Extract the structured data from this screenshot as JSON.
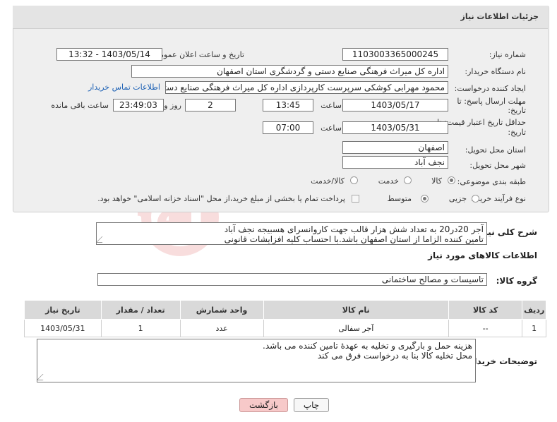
{
  "header": {
    "title": "جزئیات اطلاعات نیاز"
  },
  "fields": {
    "need_number_label": "شماره نیاز:",
    "need_number": "1103003365000245",
    "announce_label": "تاریخ و ساعت اعلان عمومی:",
    "announce_value": "1403/05/14 - 13:32",
    "buyer_org_label": "نام دستگاه خریدار:",
    "buyer_org": "اداره کل میراث فرهنگی  صنایع دستی و گردشگری استان اصفهان",
    "creator_label": "ایجاد کننده درخواست:",
    "creator": "محمود مهرابی کوشکی سرپرست کارپردازی اداره کل میراث فرهنگی  صنایع دستی و گردشگری استان اصفهان",
    "contact_link": "اطلاعات تماس خریدار",
    "send_deadline_label_1": "مهلت ارسال پاسخ: تا",
    "send_deadline_label_2": "تاریخ:",
    "send_date": "1403/05/17",
    "time_label": "ساعت",
    "send_time": "13:45",
    "days_value": "2",
    "days_label": "روز و",
    "remaining_time": "23:49:03",
    "remaining_label": "ساعت باقی مانده",
    "price_validity_label_1": "حداقل تاریخ اعتبار قیمت: تا",
    "price_validity_label_2": "تاریخ:",
    "price_date": "1403/05/31",
    "price_time": "07:00",
    "province_label": "استان محل تحویل:",
    "province": "اصفهان",
    "city_label": "شهر محل تحویل:",
    "city": "نجف آباد",
    "category_label": "طبقه بندی موضوعی:",
    "category_options": [
      "کالا",
      "خدمت",
      "کالا/خدمت"
    ],
    "process_label": "نوع فرآیند خرید :",
    "process_options": [
      "جزیی",
      "متوسط"
    ],
    "payment_note": "پرداخت تمام یا بخشی از مبلغ خرید،از محل \"اسناد خزانه اسلامی\" خواهد بود."
  },
  "description": {
    "label": "شرح کلی نیاز:",
    "line1": "آجر 20در20 به تعداد شش هزار قالب جهت کاروانسرای هسبیجه نجف آباد",
    "line2": "تامین کننده الزاما از استان اصفهان باشد.با احتساب کلیه افزایشات قانونی"
  },
  "goods": {
    "section_title": "اطلاعات کالاهای مورد نیاز",
    "group_label": "گروه کالا:",
    "group_value": "تاسیسات و مصالح ساختمانی",
    "columns": [
      "ردیف",
      "کد کالا",
      "نام کالا",
      "واحد شمارش",
      "تعداد / مقدار",
      "تاریخ نیاز"
    ],
    "rows": [
      {
        "row": "1",
        "code": "--",
        "name": "آجر سفالی",
        "unit": "عدد",
        "qty": "1",
        "date": "1403/05/31"
      }
    ]
  },
  "buyer_notes": {
    "label": "توضیحات خریدار:",
    "line1": "هزینه حمل و بارگیری و تخلیه به عهدۀ تامین کننده می باشد.",
    "line2": "محل تخلیه کالا بنا به درخواست فرق می کند"
  },
  "buttons": {
    "print": "چاپ",
    "back": "بازگشت"
  },
  "watermark_text": "AriaTender.neT",
  "colors": {
    "back_button_bg": "#f7c9c9",
    "link": "#1a5fb4",
    "header_bg": "#e4e4e4"
  }
}
